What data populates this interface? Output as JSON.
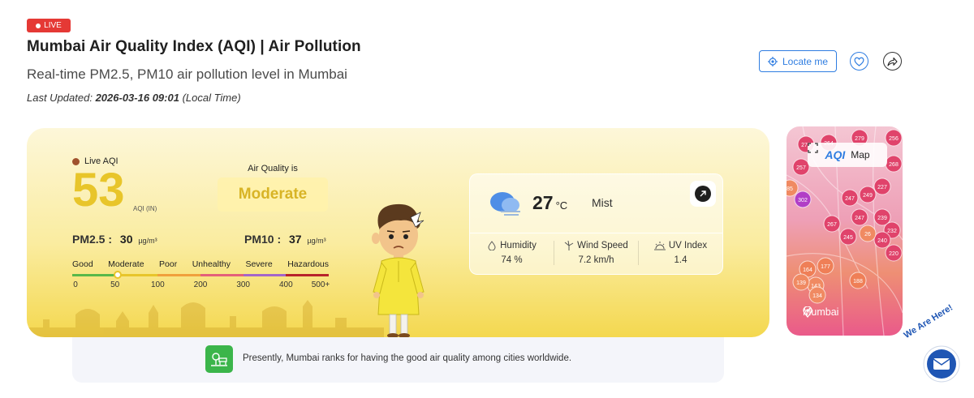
{
  "badge": {
    "label": "LIVE"
  },
  "header": {
    "title": "Mumbai Air Quality Index (AQI) | Air Pollution",
    "subtitle": "Real-time PM2.5, PM10 air pollution level in Mumbai",
    "last_updated_label": "Last Updated:",
    "last_updated_value": "2026-03-16 09:01",
    "last_updated_suffix": "(Local Time)"
  },
  "actions": {
    "locate_label": "Locate me",
    "favorite_icon": "heart-icon",
    "share_icon": "share-icon"
  },
  "aqi": {
    "live_label": "Live AQI",
    "value": "53",
    "unit": "AQI (IN)",
    "status_caption": "Air Quality is",
    "status": "Moderate",
    "status_color": "#d8b426",
    "pm25_label": "PM2.5 :",
    "pm25_value": "30",
    "pm10_label": "PM10 :",
    "pm10_value": "37",
    "pm_unit": "µg/m³"
  },
  "scale": {
    "categories": [
      "Good",
      "Moderate",
      "Poor",
      "Unhealthy",
      "Severe",
      "Hazardous"
    ],
    "colors": [
      "#59b84a",
      "#e8c52a",
      "#f0a03c",
      "#e4607a",
      "#a366c9",
      "#b8232a"
    ],
    "ticks": [
      "0",
      "50",
      "100",
      "200",
      "300",
      "400",
      "500+"
    ],
    "marker_value": 53
  },
  "weather": {
    "temperature": "27",
    "temperature_unit": "°C",
    "condition": "Mist",
    "humidity_label": "Humidity",
    "humidity_value": "74 %",
    "wind_label": "Wind Speed",
    "wind_value": "7.2 km/h",
    "uv_label": "UV Index",
    "uv_value": "1.4"
  },
  "notice": {
    "text": "Presently, Mumbai ranks for having the good air quality among cities worldwide."
  },
  "map": {
    "brand": "AQI",
    "label": "Map",
    "city": "Mumbai",
    "markers": [
      "270",
      "264",
      "279",
      "256",
      "257",
      "268",
      "227",
      "302",
      "247",
      "249",
      "85",
      "247",
      "267",
      "239",
      "245",
      "232",
      "240",
      "26",
      "220",
      "177",
      "164",
      "143",
      "139",
      "188",
      "134"
    ]
  },
  "chat": {
    "label": "We Are Here!"
  }
}
